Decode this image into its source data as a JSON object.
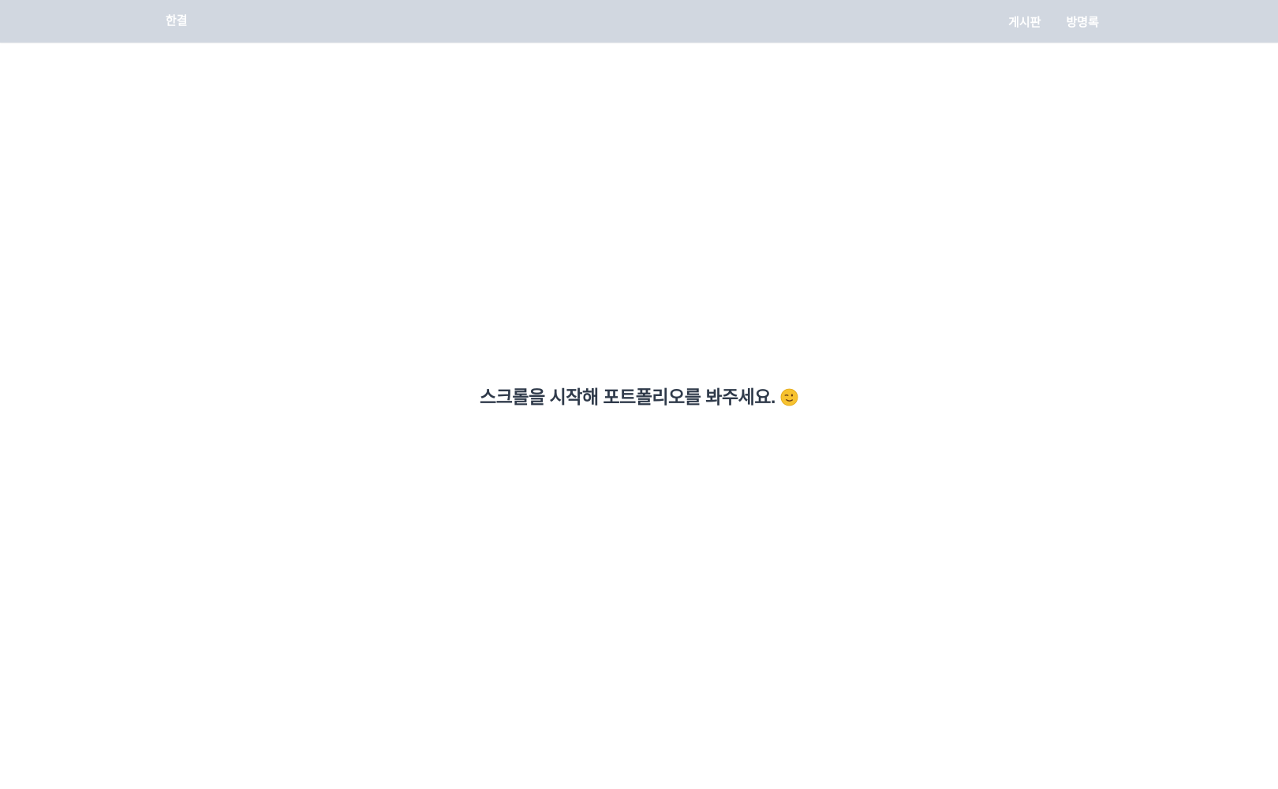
{
  "header": {
    "brand": "한결",
    "nav": [
      "게시판",
      "방명록"
    ]
  },
  "main": {
    "hero_text": "스크롤을 시작해 포트폴리오를 봐주세요.",
    "hero_icon": "winking-face-icon"
  },
  "colors": {
    "header_bg": "#d1d7e0",
    "header_text": "#ffffff",
    "hero_text": "#2f3a4a",
    "emoji_yellow": "#f7c22f"
  }
}
